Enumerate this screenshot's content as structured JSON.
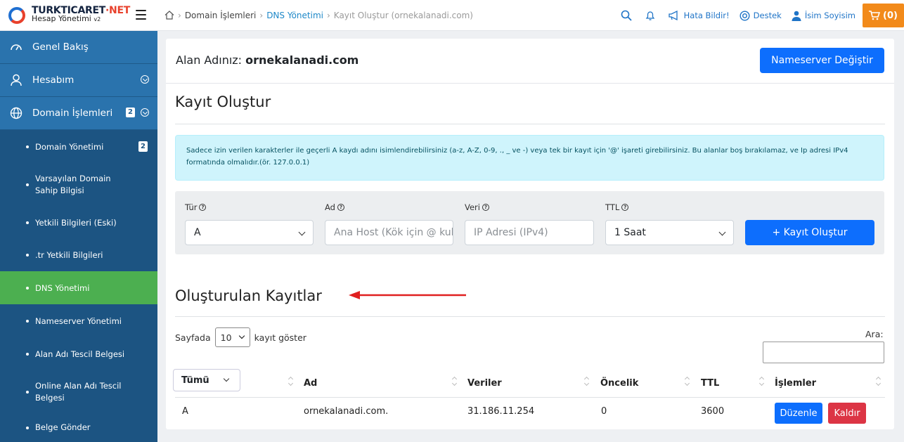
{
  "logo": {
    "brand": "TURKTICARET",
    "brand_net": "·NET",
    "sub": "Hesap Yönetimi",
    "version": "v2"
  },
  "breadcrumb": {
    "items": [
      "Domain İşlemleri",
      "DNS Yönetimi",
      "Kayıt Oluştur (ornekalanadi.com)"
    ]
  },
  "topbar": {
    "report": "Hata Bildir!",
    "support": "Destek",
    "user": "İsim Soyisim",
    "cart": "(0)"
  },
  "sidebar": {
    "main": [
      {
        "label": "Genel Bakış",
        "icon": "dashboard-icon"
      },
      {
        "label": "Hesabım",
        "icon": "user-icon"
      },
      {
        "label": "Domain İşlemleri",
        "icon": "globe-icon",
        "badge": "2"
      }
    ],
    "sub": [
      {
        "label": "Domain Yönetimi",
        "badge": "2"
      },
      {
        "label": "Varsayılan Domain Sahip Bilgisi"
      },
      {
        "label": "Yetkili Bilgileri (Eski)"
      },
      {
        "label": ".tr Yetkili Bilgileri"
      },
      {
        "label": "DNS Yönetimi",
        "active": true
      },
      {
        "label": "Nameserver Yönetimi"
      },
      {
        "label": "Alan Adı Tescil Belgesi"
      },
      {
        "label": "Online Alan Adı Tescil Belgesi"
      },
      {
        "label": "Belge Gönder"
      }
    ]
  },
  "main": {
    "domain_label": "Alan Adınız:",
    "domain": "ornekalanadi.com",
    "ns_button": "Nameserver Değiştir",
    "create_title": "Kayıt Oluştur",
    "alert": "Sadece izin verilen karakterler ile geçerli A kaydı adını isimlendirebilirsiniz (a-z, A-Z, 0-9, ., _ ve -) veya tek bir kayıt için '@' işareti girebilirsiniz. Bu alanlar boş bırakılamaz, ve Ip adresi IPv4 formatında olmalıdır.(ör. 127.0.0.1)",
    "form": {
      "type_label": "Tür",
      "type_value": "A",
      "name_label": "Ad",
      "name_placeholder": "Ana Host (Kök için @ kullanın)",
      "data_label": "Veri",
      "data_placeholder": "IP Adresi (IPv4)",
      "ttl_label": "TTL",
      "ttl_value": "1 Saat",
      "submit": "+ Kayıt Oluştur"
    },
    "records_title": "Oluşturulan Kayıtlar",
    "per_page_prefix": "Sayfada",
    "per_page_value": "10",
    "per_page_suffix": "kayıt göster",
    "search_label": "Ara:",
    "table": {
      "filter": "Tümü",
      "headers": [
        "Ad",
        "Veriler",
        "Öncelik",
        "TTL",
        "İşlemler"
      ],
      "rows": [
        {
          "type": "A",
          "name": "ornekalanadi.com.",
          "data": "31.186.11.254",
          "priority": "0",
          "ttl": "3600",
          "edit": "Düzenle",
          "delete": "Kaldır"
        }
      ]
    }
  },
  "colors": {
    "sidebar": "#1f5f94",
    "active": "#4caf50",
    "primary": "#0d6efd",
    "danger": "#dc3545",
    "cart": "#f28a1a",
    "arrow": "#e02020"
  }
}
